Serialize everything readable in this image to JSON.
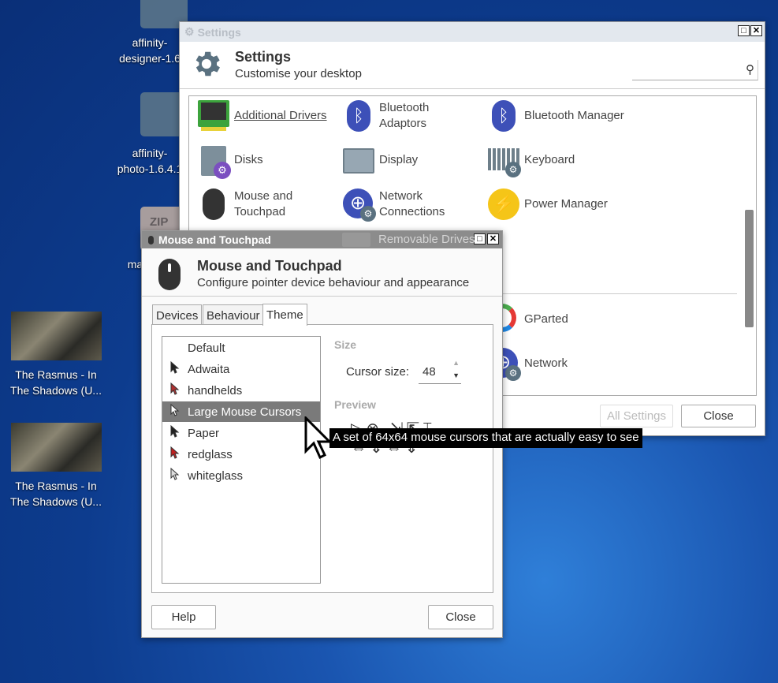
{
  "desktop": {
    "icons": [
      {
        "label_line1": "affinity-",
        "label_line2": "designer-1.6"
      },
      {
        "label_line1": "affinity-",
        "label_line2": "photo-1.6.4.1"
      },
      {
        "label_line1": "ZIP",
        "label_line2": "mac"
      },
      {
        "label_line1": "The Rasmus - In",
        "label_line2": "The Shadows (U..."
      },
      {
        "label_line1": "The Rasmus - In",
        "label_line2": "The Shadows (U..."
      }
    ]
  },
  "settings": {
    "window_title": "Settings",
    "title": "Settings",
    "subtitle": "Customise your desktop",
    "search_placeholder": "",
    "items": [
      {
        "label": "Additional Drivers",
        "icon": "drivers-icon"
      },
      {
        "label": "Bluetooth Adaptors",
        "icon": "bluetooth-icon"
      },
      {
        "label": "Bluetooth Manager",
        "icon": "bluetooth-icon"
      },
      {
        "label": "Disks",
        "icon": "disks-icon"
      },
      {
        "label": "Display",
        "icon": "display-icon"
      },
      {
        "label": "Keyboard",
        "icon": "keyboard-icon"
      },
      {
        "label": "Mouse and Touchpad",
        "icon": "mouse-icon"
      },
      {
        "label": "Network Connections",
        "icon": "network-icon"
      },
      {
        "label": "Power Manager",
        "icon": "power-icon"
      },
      {
        "label": "Removable Drives",
        "icon": "drive-icon"
      },
      {
        "label": "GParted",
        "icon": "gparted-icon"
      },
      {
        "label": "Network",
        "icon": "network-icon"
      }
    ],
    "all_settings_label": "All Settings",
    "close_label": "Close"
  },
  "mouse": {
    "window_title": "Mouse and Touchpad",
    "title": "Mouse and Touchpad",
    "subtitle": "Configure pointer device behaviour and appearance",
    "tabs": [
      {
        "label": "Devices"
      },
      {
        "label": "Behaviour"
      },
      {
        "label": "Theme",
        "active": true
      }
    ],
    "themes": [
      {
        "label": "Default",
        "cursor": ""
      },
      {
        "label": "Adwaita",
        "cursor": "#222222"
      },
      {
        "label": "handhelds",
        "cursor": "#b03030"
      },
      {
        "label": "Large Mouse Cursors",
        "cursor": "#ffffff",
        "selected": true
      },
      {
        "label": "Paper",
        "cursor": "#222222"
      },
      {
        "label": "redglass",
        "cursor": "#c02020"
      },
      {
        "label": "whiteglass",
        "cursor": "#dddddd"
      }
    ],
    "size_heading": "Size",
    "cursor_size_label": "Cursor size:",
    "cursor_size_value": "48",
    "preview_heading": "Preview",
    "tooltip": "A set of 64x64 mouse cursors that are actually easy to see",
    "help_label": "Help",
    "close_label": "Close"
  }
}
